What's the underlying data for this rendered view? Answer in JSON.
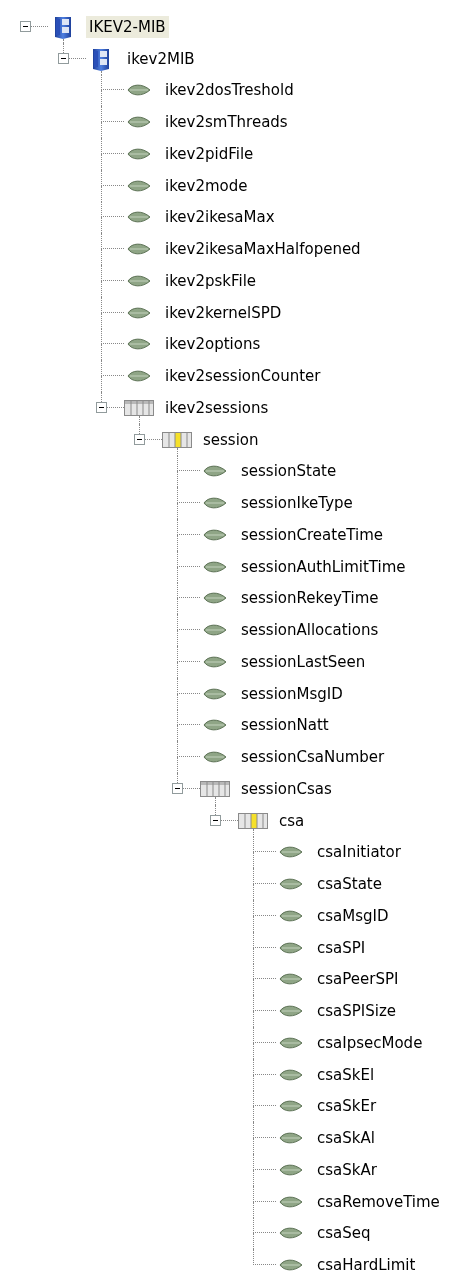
{
  "tree": [
    {
      "label": "IKEV2-MIB",
      "kind": "mib",
      "expanded": true,
      "selected": true,
      "children": [
        {
          "label": "ikev2MIB",
          "kind": "mib",
          "expanded": true,
          "selected": false,
          "children": [
            {
              "label": "ikev2dosTreshold",
              "kind": "leaf",
              "selected": false
            },
            {
              "label": "ikev2smThreads",
              "kind": "leaf",
              "selected": false
            },
            {
              "label": "ikev2pidFile",
              "kind": "leaf",
              "selected": false
            },
            {
              "label": "ikev2mode",
              "kind": "leaf",
              "selected": false
            },
            {
              "label": "ikev2ikesaMax",
              "kind": "leaf",
              "selected": false
            },
            {
              "label": "ikev2ikesaMaxHalfopened",
              "kind": "leaf",
              "selected": false
            },
            {
              "label": "ikev2pskFile",
              "kind": "leaf",
              "selected": false
            },
            {
              "label": "ikev2kernelSPD",
              "kind": "leaf",
              "selected": false
            },
            {
              "label": "ikev2options",
              "kind": "leaf",
              "selected": false
            },
            {
              "label": "ikev2sessionCounter",
              "kind": "leaf",
              "selected": false
            },
            {
              "label": "ikev2sessions",
              "kind": "table",
              "expanded": true,
              "selected": false,
              "children": [
                {
                  "label": "session",
                  "kind": "entry",
                  "expanded": true,
                  "selected": false,
                  "children": [
                    {
                      "label": "sessionState",
                      "kind": "leaf",
                      "selected": false
                    },
                    {
                      "label": "sessionIkeType",
                      "kind": "leaf",
                      "selected": false
                    },
                    {
                      "label": "sessionCreateTime",
                      "kind": "leaf",
                      "selected": false
                    },
                    {
                      "label": "sessionAuthLimitTime",
                      "kind": "leaf",
                      "selected": false
                    },
                    {
                      "label": "sessionRekeyTime",
                      "kind": "leaf",
                      "selected": false
                    },
                    {
                      "label": "sessionAllocations",
                      "kind": "leaf",
                      "selected": false
                    },
                    {
                      "label": "sessionLastSeen",
                      "kind": "leaf",
                      "selected": false
                    },
                    {
                      "label": "sessionMsgID",
                      "kind": "leaf",
                      "selected": false
                    },
                    {
                      "label": "sessionNatt",
                      "kind": "leaf",
                      "selected": false
                    },
                    {
                      "label": "sessionCsaNumber",
                      "kind": "leaf",
                      "selected": false
                    },
                    {
                      "label": "sessionCsas",
                      "kind": "table",
                      "expanded": true,
                      "selected": false,
                      "children": [
                        {
                          "label": "csa",
                          "kind": "entry",
                          "expanded": true,
                          "selected": false,
                          "children": [
                            {
                              "label": "csaInitiator",
                              "kind": "leaf",
                              "selected": false
                            },
                            {
                              "label": "csaState",
                              "kind": "leaf",
                              "selected": false
                            },
                            {
                              "label": "csaMsgID",
                              "kind": "leaf",
                              "selected": false
                            },
                            {
                              "label": "csaSPI",
                              "kind": "leaf",
                              "selected": false
                            },
                            {
                              "label": "csaPeerSPI",
                              "kind": "leaf",
                              "selected": false
                            },
                            {
                              "label": "csaSPISize",
                              "kind": "leaf",
                              "selected": false
                            },
                            {
                              "label": "csaIpsecMode",
                              "kind": "leaf",
                              "selected": false
                            },
                            {
                              "label": "csaSkEl",
                              "kind": "leaf",
                              "selected": false
                            },
                            {
                              "label": "csaSkEr",
                              "kind": "leaf",
                              "selected": false
                            },
                            {
                              "label": "csaSkAl",
                              "kind": "leaf",
                              "selected": false
                            },
                            {
                              "label": "csaSkAr",
                              "kind": "leaf",
                              "selected": false
                            },
                            {
                              "label": "csaRemoveTime",
                              "kind": "leaf",
                              "selected": false
                            },
                            {
                              "label": "csaSeq",
                              "kind": "leaf",
                              "selected": false
                            },
                            {
                              "label": "csaHardLimit",
                              "kind": "leaf",
                              "selected": false
                            }
                          ]
                        }
                      ]
                    }
                  ]
                }
              ]
            }
          ]
        }
      ]
    }
  ]
}
